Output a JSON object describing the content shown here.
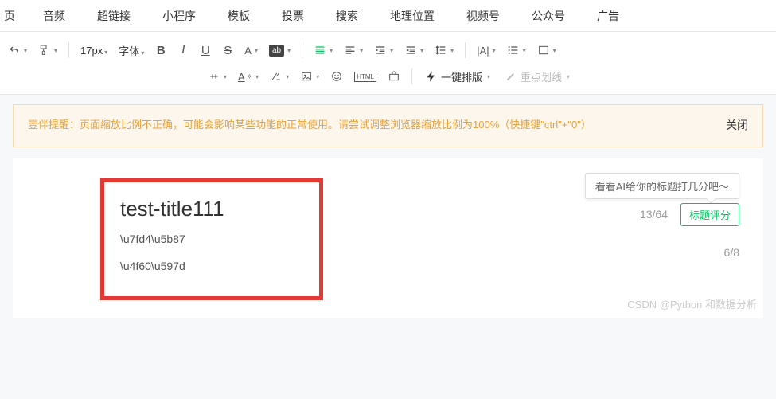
{
  "tabs": [
    "页",
    "音频",
    "超链接",
    "小程序",
    "模板",
    "投票",
    "搜索",
    "地理位置",
    "视频号",
    "公众号",
    "广告"
  ],
  "toolbar": {
    "font_size": "17px",
    "font_family": "字体",
    "oneclick": "一键排版",
    "keyline": "重点划线"
  },
  "alert": {
    "text": "壹伴提醒：页面缩放比例不正确，可能会影响某些功能的正常使用。请尝试调整浏览器缩放比例为100%（快捷键\"ctrl\"+\"0\"）",
    "close": "关闭"
  },
  "editor": {
    "tooltip": "看看AI给你的标题打几分吧～",
    "title": "test-title111",
    "line1": "\\u7fd4\\u5b87",
    "line2": "\\u4f60\\u597d",
    "counter1": "13/64",
    "score_btn": "标题评分",
    "counter2": "6/8"
  },
  "watermark": "CSDN @Python 和数据分析"
}
